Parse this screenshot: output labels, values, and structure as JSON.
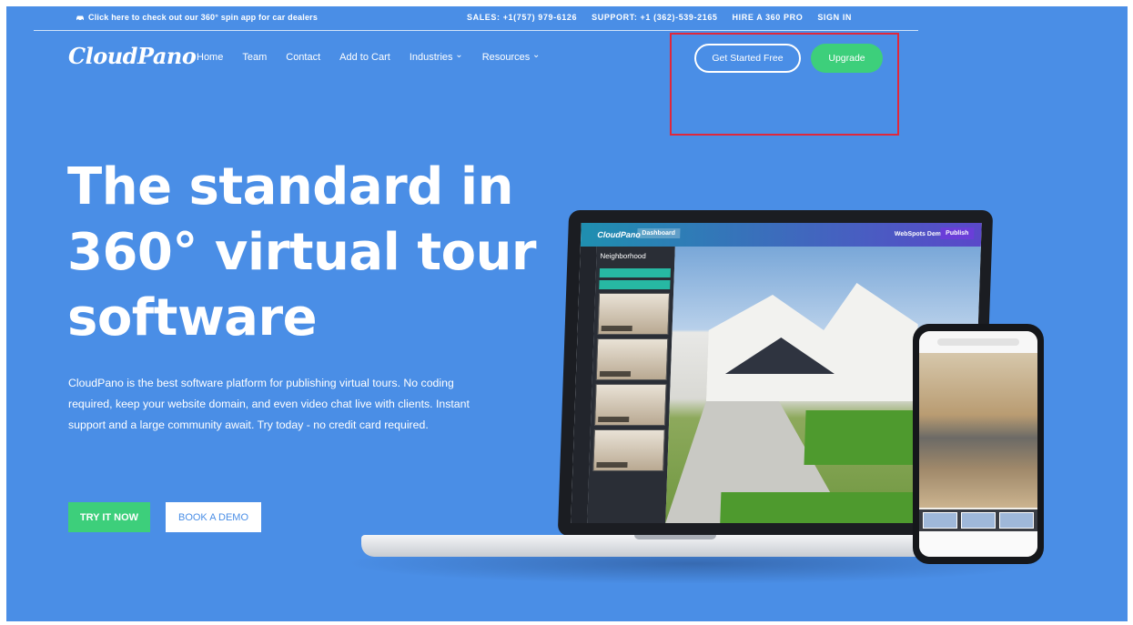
{
  "topbar": {
    "promo": "Click here to check out our 360° spin app for car dealers",
    "sales": "SALES: +1(757) 979-6126",
    "support": "SUPPORT: +1 (362)-539-2165",
    "hire": "HIRE A 360 PRO",
    "signin": "SIGN IN"
  },
  "brand": {
    "logo": "CloudPano"
  },
  "nav": {
    "items": [
      "Home",
      "Team",
      "Contact",
      "Add to Cart",
      "Industries",
      "Resources"
    ]
  },
  "header_actions": {
    "get_started": "Get Started Free",
    "upgrade": "Upgrade"
  },
  "hero": {
    "title_line1": "The standard in",
    "title_line2": "360° virtual tour",
    "title_line3": "software",
    "description": "CloudPano is the best software platform for publishing virtual tours. No coding required, keep your website domain, and even video chat live with clients. Instant support and a large community await. Try today - no credit card required.",
    "try_now": "TRY IT NOW",
    "book_demo": "BOOK A DEMO"
  },
  "mockup": {
    "app_brand": "CloudPano",
    "app_tag": "Dashboard",
    "app_user": "WebSpots Demo",
    "app_publish": "Publish",
    "sidebar_title": "Neighborhood"
  },
  "colors": {
    "background": "#4a8ee6",
    "accent_green": "#3dcf7b",
    "highlight_red": "#e0273b"
  }
}
